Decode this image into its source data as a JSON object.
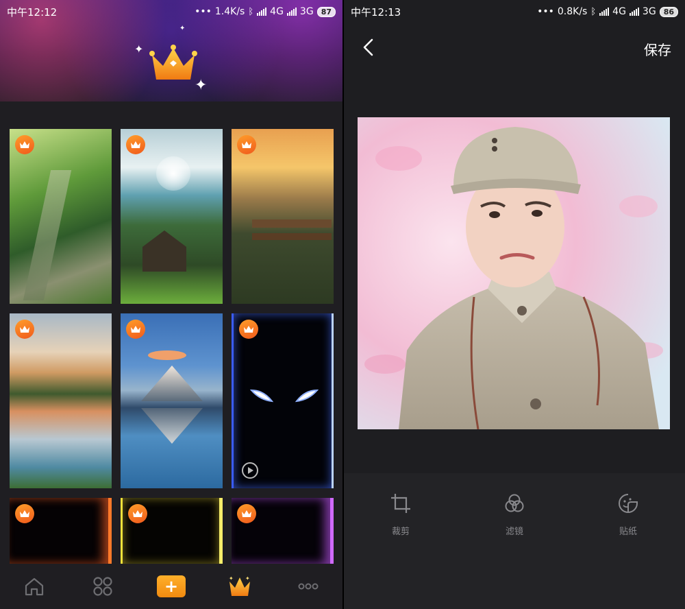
{
  "left_status": {
    "time": "中午12:12",
    "speed": "1.4K/s",
    "net1": "4G",
    "net2": "3G",
    "battery": "87"
  },
  "right_status": {
    "time": "中午12:13",
    "speed": "0.8K/s",
    "net1": "4G",
    "net2": "3G",
    "battery": "86"
  },
  "left_screen": {
    "header_icon": "crown-icon",
    "wallpapers": [
      {
        "name": "valley-gorge",
        "vip": true
      },
      {
        "name": "cabin-lake",
        "vip": true
      },
      {
        "name": "sunset-bench",
        "vip": true
      },
      {
        "name": "mountain-lake-reflection",
        "vip": true
      },
      {
        "name": "matterhorn-reflection",
        "vip": true
      },
      {
        "name": "glowing-eyes",
        "vip": true,
        "video": true
      },
      {
        "name": "orange-edge-glow",
        "vip": true
      },
      {
        "name": "yellow-edge-glow",
        "vip": true
      },
      {
        "name": "purple-edge-glow",
        "vip": true
      }
    ],
    "nav": [
      {
        "icon": "home-icon"
      },
      {
        "icon": "grid-icon"
      },
      {
        "icon": "plus-icon",
        "label": "+"
      },
      {
        "icon": "vip-crown-icon"
      },
      {
        "icon": "more-icon"
      }
    ],
    "accent": "#f39c1f"
  },
  "right_screen": {
    "save_label": "保存",
    "tools": [
      {
        "icon": "crop-icon",
        "label": "裁剪"
      },
      {
        "icon": "filter-icon",
        "label": "滤镜"
      },
      {
        "icon": "sticker-icon",
        "label": "贴纸"
      }
    ]
  }
}
